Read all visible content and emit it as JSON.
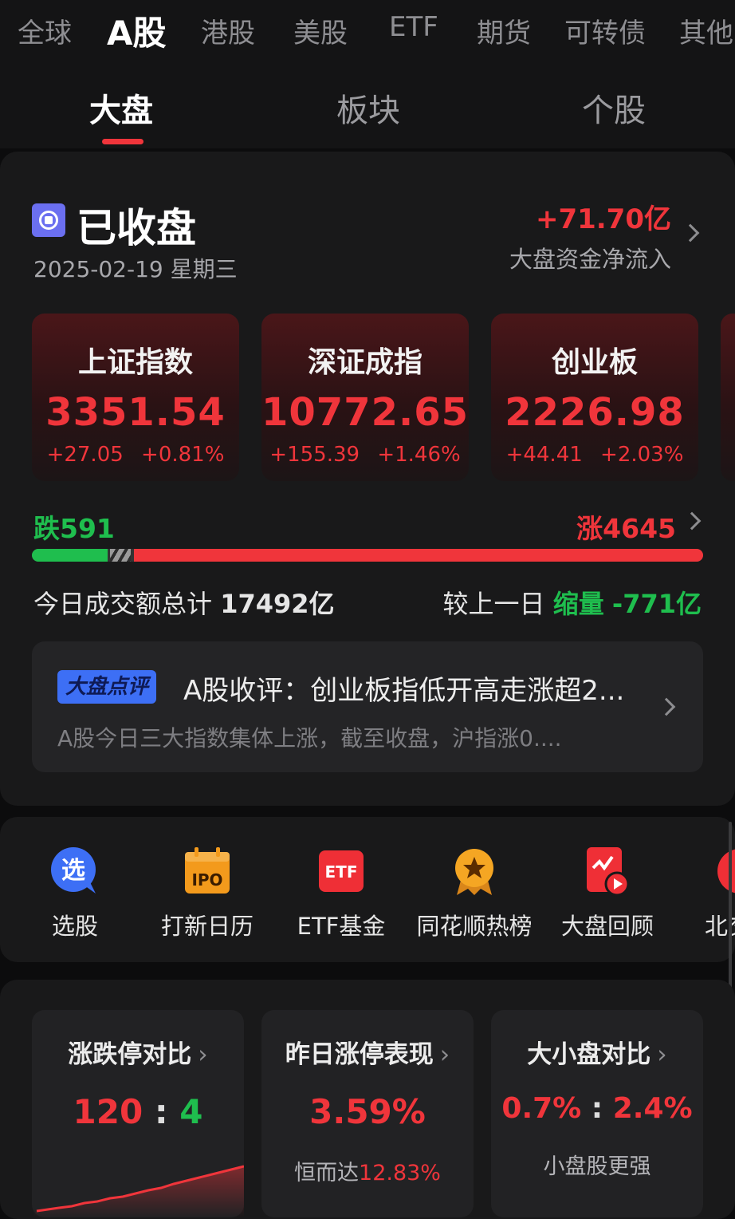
{
  "market_tabs": [
    "全球",
    "A股",
    "港股",
    "美股",
    "ETF",
    "期货",
    "可转债",
    "其他"
  ],
  "sub_tabs": [
    "大盘",
    "板块",
    "个股"
  ],
  "status": {
    "title": "已收盘",
    "date": "2025-02-19 星期三",
    "flow_value": "+71.70亿",
    "flow_label": "大盘资金净流入"
  },
  "indices": [
    {
      "name": "上证指数",
      "value": "3351.54",
      "change": "+27.05",
      "pct": "+0.81%"
    },
    {
      "name": "深证成指",
      "value": "10772.65",
      "change": "+155.39",
      "pct": "+1.46%"
    },
    {
      "name": "创业板",
      "value": "2226.98",
      "change": "+44.41",
      "pct": "+2.03%"
    }
  ],
  "breadth": {
    "fall": "跌591",
    "rise": "涨4645",
    "fall_fraction": 0.113,
    "rise_fraction": 0.887
  },
  "turnover": {
    "label": "今日成交额总计",
    "value": "17492亿",
    "compare_label": "较上一日",
    "compare_state": "缩量",
    "compare_value": "-771亿"
  },
  "news": {
    "badge": "大盘点评",
    "title": "A股收评：创业板指低开高走涨超2...",
    "summary": "A股今日三大指数集体上涨，截至收盘，沪指涨0...."
  },
  "quick_entries": [
    {
      "label": "选股",
      "icon_text": "选",
      "icon": "stock-picker-icon"
    },
    {
      "label": "打新日历",
      "icon_text": "IPO",
      "icon": "ipo-calendar-icon"
    },
    {
      "label": "ETF基金",
      "icon_text": "ETF",
      "icon": "etf-icon"
    },
    {
      "label": "同花顺热榜",
      "icon_text": "",
      "icon": "hot-list-icon"
    },
    {
      "label": "大盘回顾",
      "icon_text": "",
      "icon": "market-review-icon"
    },
    {
      "label": "北交",
      "icon_text": "",
      "icon": "beijiao-icon"
    }
  ],
  "stats": [
    {
      "title": "涨跌停对比",
      "value_a": "120",
      "sep": ":",
      "value_b": "4",
      "note": ""
    },
    {
      "title": "昨日涨停表现",
      "value": "3.59%",
      "note_prefix": "恒而达",
      "note_value": "12.83%"
    },
    {
      "title": "大小盘对比",
      "value_a": "0.7%",
      "sep": ":",
      "value_b": "2.4%",
      "note": "小盘股更强"
    }
  ],
  "colors": {
    "up": "#f0353b",
    "down": "#1fbe4e",
    "accent": "#6b6ff0"
  }
}
